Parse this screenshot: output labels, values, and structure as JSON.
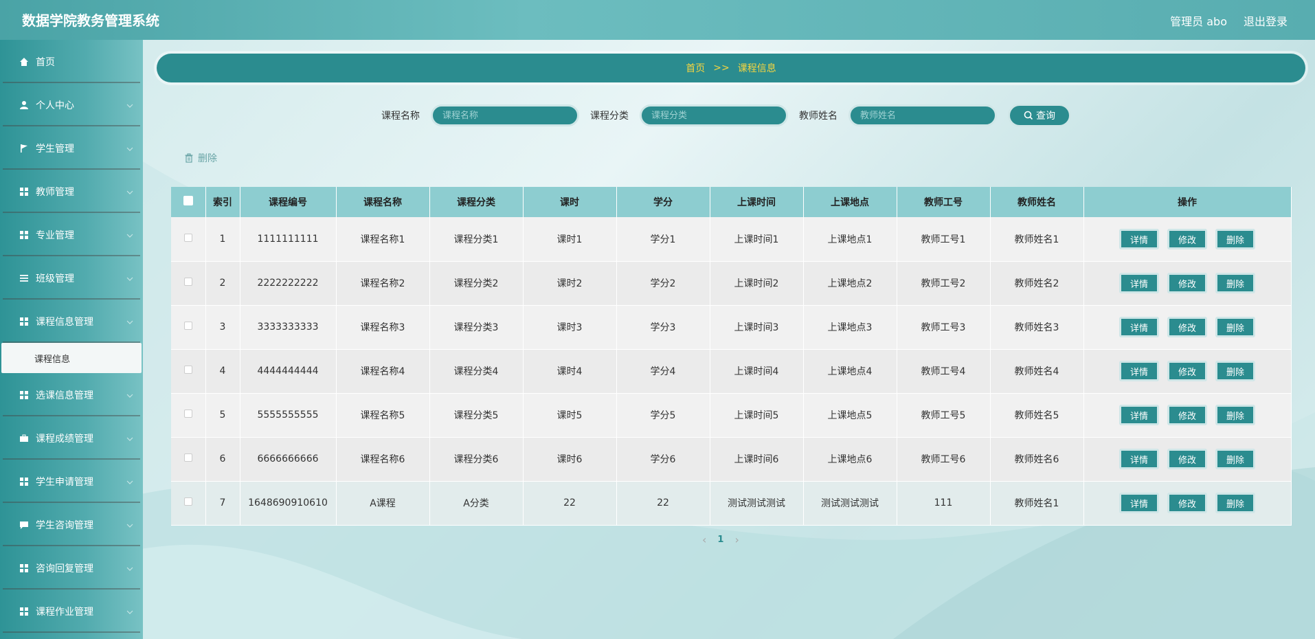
{
  "header": {
    "title": "数据学院教务管理系统",
    "user": "管理员 abo",
    "logout": "退出登录"
  },
  "sidebar": {
    "items": [
      {
        "label": "首页",
        "icon": "home-icon",
        "has_children": false
      },
      {
        "label": "个人中心",
        "icon": "user-icon",
        "has_children": true
      },
      {
        "label": "学生管理",
        "icon": "flag-icon",
        "has_children": true
      },
      {
        "label": "教师管理",
        "icon": "grid-icon",
        "has_children": true
      },
      {
        "label": "专业管理",
        "icon": "grid-icon",
        "has_children": true
      },
      {
        "label": "班级管理",
        "icon": "list-icon",
        "has_children": true
      },
      {
        "label": "课程信息管理",
        "icon": "grid-icon",
        "has_children": true
      },
      {
        "label": "选课信息管理",
        "icon": "grid-icon",
        "has_children": true
      },
      {
        "label": "课程成绩管理",
        "icon": "briefcase-icon",
        "has_children": true
      },
      {
        "label": "学生申请管理",
        "icon": "grid-icon",
        "has_children": true
      },
      {
        "label": "学生咨询管理",
        "icon": "chat-icon",
        "has_children": true
      },
      {
        "label": "咨询回复管理",
        "icon": "grid-icon",
        "has_children": true
      },
      {
        "label": "课程作业管理",
        "icon": "grid-icon",
        "has_children": true
      }
    ],
    "active_sub": "课程信息"
  },
  "breadcrumb": {
    "home": "首页",
    "sep": ">>",
    "current": "课程信息"
  },
  "search": {
    "fields": [
      {
        "label": "课程名称",
        "placeholder": "课程名称"
      },
      {
        "label": "课程分类",
        "placeholder": "课程分类"
      },
      {
        "label": "教师姓名",
        "placeholder": "教师姓名"
      }
    ],
    "button": "查询"
  },
  "toolbar": {
    "delete": "删除"
  },
  "table": {
    "columns": [
      "索引",
      "课程编号",
      "课程名称",
      "课程分类",
      "课时",
      "学分",
      "上课时间",
      "上课地点",
      "教师工号",
      "教师姓名",
      "操作"
    ],
    "rows": [
      [
        "1",
        "1111111111",
        "课程名称1",
        "课程分类1",
        "课时1",
        "学分1",
        "上课时间1",
        "上课地点1",
        "教师工号1",
        "教师姓名1"
      ],
      [
        "2",
        "2222222222",
        "课程名称2",
        "课程分类2",
        "课时2",
        "学分2",
        "上课时间2",
        "上课地点2",
        "教师工号2",
        "教师姓名2"
      ],
      [
        "3",
        "3333333333",
        "课程名称3",
        "课程分类3",
        "课时3",
        "学分3",
        "上课时间3",
        "上课地点3",
        "教师工号3",
        "教师姓名3"
      ],
      [
        "4",
        "4444444444",
        "课程名称4",
        "课程分类4",
        "课时4",
        "学分4",
        "上课时间4",
        "上课地点4",
        "教师工号4",
        "教师姓名4"
      ],
      [
        "5",
        "5555555555",
        "课程名称5",
        "课程分类5",
        "课时5",
        "学分5",
        "上课时间5",
        "上课地点5",
        "教师工号5",
        "教师姓名5"
      ],
      [
        "6",
        "6666666666",
        "课程名称6",
        "课程分类6",
        "课时6",
        "学分6",
        "上课时间6",
        "上课地点6",
        "教师工号6",
        "教师姓名6"
      ],
      [
        "7",
        "1648690910610",
        "A课程",
        "A分类",
        "22",
        "22",
        "测试测试测试",
        "测试测试测试",
        "111",
        "教师姓名1"
      ]
    ],
    "actions": [
      "详情",
      "修改",
      "删除"
    ]
  },
  "pagination": {
    "current": "1",
    "prev": "‹",
    "next": "›"
  },
  "colors": {
    "primary": "#2b8c8f",
    "header_bg": "#58adb0",
    "breadcrumb_text": "#f5d540",
    "table_head": "#8dcdd0"
  }
}
